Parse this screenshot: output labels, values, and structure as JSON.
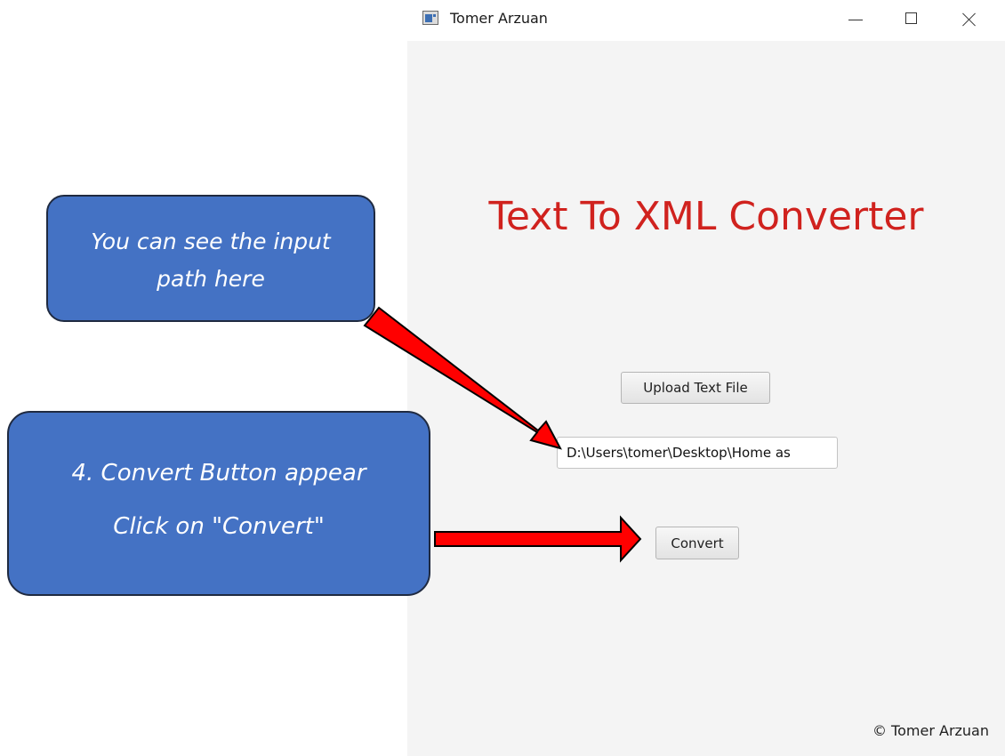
{
  "window": {
    "title": "Tomer Arzuan",
    "controls": {
      "minimize": "minimize-icon",
      "maximize": "maximize-icon",
      "close": "close-icon"
    }
  },
  "app": {
    "heading": "Text To XML Converter",
    "upload_button": "Upload Text File",
    "path_value": "D:\\Users\\tomer\\Desktop\\Home as",
    "convert_button": "Convert",
    "footer": "© Tomer Arzuan"
  },
  "callouts": [
    {
      "lines": [
        "You can see the input",
        "path here"
      ]
    },
    {
      "lines": [
        "4. Convert Button appear",
        "Click on \"Convert\""
      ]
    }
  ],
  "colors": {
    "heading": "#d0221e",
    "callout_fill": "#4472c4",
    "arrow_fill": "#ff0000",
    "window_bg": "#f4f4f4"
  }
}
